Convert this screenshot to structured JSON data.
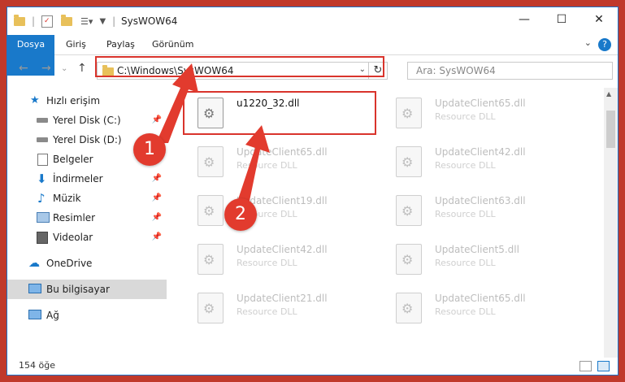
{
  "window": {
    "title": "SysWOW64",
    "minimize": "—",
    "maximize": "☐",
    "close": "✕"
  },
  "ribbon": {
    "tabs": [
      "Dosya",
      "Giriş",
      "Paylaş",
      "Görünüm"
    ],
    "help": "?",
    "collapse": "⌄"
  },
  "nav": {
    "back": "←",
    "forward": "→",
    "up": "↑",
    "recent": "⌄"
  },
  "address": {
    "path": "C:\\Windows\\SysWOW64",
    "dropdown": "⌄",
    "refresh": "↻"
  },
  "search": {
    "placeholder": "Ara: SysWOW64"
  },
  "sidebar": {
    "items": [
      {
        "label": "Hızlı erişim",
        "icon": "star-icon",
        "pinned": false
      },
      {
        "label": "Yerel Disk (C:)",
        "icon": "drive-icon",
        "pinned": true
      },
      {
        "label": "Yerel Disk (D:)",
        "icon": "drive-icon",
        "pinned": true
      },
      {
        "label": "Belgeler",
        "icon": "document-icon",
        "pinned": true
      },
      {
        "label": "İndirmeler",
        "icon": "download-icon",
        "pinned": true
      },
      {
        "label": "Müzik",
        "icon": "music-icon",
        "pinned": true
      },
      {
        "label": "Resimler",
        "icon": "picture-icon",
        "pinned": true
      },
      {
        "label": "Videolar",
        "icon": "video-icon",
        "pinned": true
      },
      {
        "label": "OneDrive",
        "icon": "cloud-icon",
        "pinned": false
      },
      {
        "label": "Bu bilgisayar",
        "icon": "computer-icon",
        "pinned": false
      },
      {
        "label": "Ağ",
        "icon": "network-icon",
        "pinned": false
      }
    ]
  },
  "files": [
    {
      "name": "u1220_32.dll",
      "type": "",
      "focus": true
    },
    {
      "name": "UpdateClient65.dll",
      "type": "Resource DLL",
      "focus": false
    },
    {
      "name": "UpdateClient65.dll",
      "type": "Resource DLL",
      "focus": false
    },
    {
      "name": "UpdateClient42.dll",
      "type": "Resource DLL",
      "focus": false
    },
    {
      "name": "UpdateClient19.dll",
      "type": "Resource DLL",
      "focus": false
    },
    {
      "name": "UpdateClient63.dll",
      "type": "Resource DLL",
      "focus": false
    },
    {
      "name": "UpdateClient42.dll",
      "type": "Resource DLL",
      "focus": false
    },
    {
      "name": "UpdateClient5.dll",
      "type": "Resource DLL",
      "focus": false
    },
    {
      "name": "UpdateClient21.dll",
      "type": "Resource DLL",
      "focus": false
    },
    {
      "name": "UpdateClient65.dll",
      "type": "Resource DLL",
      "focus": false
    }
  ],
  "status": {
    "count": "154 öğe"
  },
  "annotations": {
    "step1": "1",
    "step2": "2",
    "color": "#e23b2e"
  },
  "colors": {
    "accent": "#1979ca",
    "highlight": "#d9342c"
  }
}
